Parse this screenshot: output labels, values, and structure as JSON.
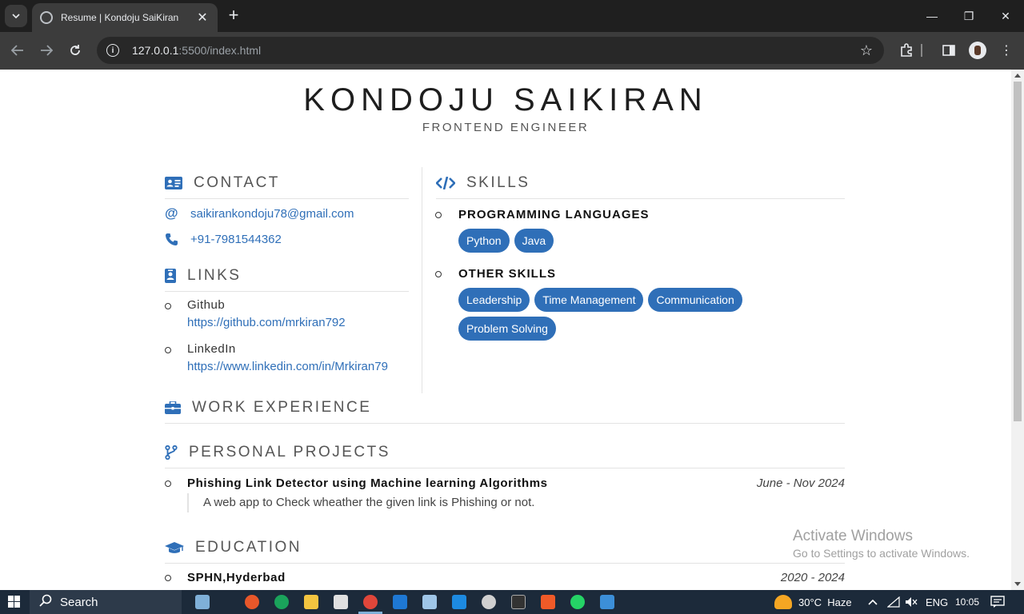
{
  "browser": {
    "tab_title": "Resume | Kondoju SaiKiran",
    "url_host": "127.0.0.1",
    "url_path": ":5500/index.html"
  },
  "resume": {
    "name": "KONDOJU SAIKIRAN",
    "role": "FRONTEND ENGINEER",
    "contact": {
      "heading": "CONTACT",
      "email": "saikirankondoju78@gmail.com",
      "phone": "+91-7981544362"
    },
    "links": {
      "heading": "LINKS",
      "items": [
        {
          "label": "Github",
          "url": "https://github.com/mrkiran792"
        },
        {
          "label": "LinkedIn",
          "url": "https://www.linkedin.com/in/Mrkiran79"
        }
      ]
    },
    "skills": {
      "heading": "SKILLS",
      "categories": [
        {
          "name": "PROGRAMMING LANGUAGES",
          "items": [
            "Python",
            "Java"
          ]
        },
        {
          "name": "OTHER SKILLS",
          "items": [
            "Leadership",
            "Time Management",
            "Communication",
            "Problem Solving"
          ]
        }
      ]
    },
    "work": {
      "heading": "WORK EXPERIENCE"
    },
    "projects": {
      "heading": "PERSONAL PROJECTS",
      "items": [
        {
          "title": "Phishing Link Detector using Machine learning Algorithms",
          "date": "June - Nov 2024",
          "desc": "A web app to Check wheather the given link is Phishing or not."
        }
      ]
    },
    "education": {
      "heading": "EDUCATION",
      "items": [
        {
          "title": "SPHN,Hyderbad",
          "date": "2020 - 2024"
        }
      ]
    }
  },
  "watermark": {
    "line1": "Activate Windows",
    "line2": "Go to Settings to activate Windows."
  },
  "taskbar": {
    "search": "Search",
    "weather": "30°C  Haze",
    "lang": "ENG",
    "time": "10:05"
  },
  "colors": {
    "accent": "#2f6fb8"
  }
}
